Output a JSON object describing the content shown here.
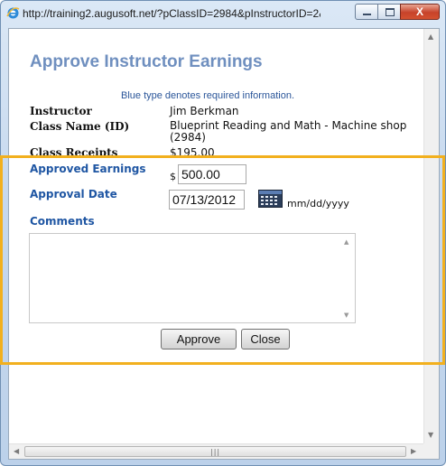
{
  "window": {
    "title": "http://training2.augusoft.net/?pClassID=2984&pInstructorID=2& - ...",
    "close_glyph": "X"
  },
  "page": {
    "heading": "Approve Instructor Earnings",
    "required_note": "Blue type denotes required information.",
    "fields": {
      "instructor_label": "Instructor",
      "instructor_value": "Jim Berkman",
      "class_label": "Class Name (ID)",
      "class_value": "Blueprint Reading and Math - Machine shop (2984)",
      "receipts_label": "Class Receipts",
      "receipts_value": "$195.00"
    },
    "form": {
      "earnings_label": "Approved Earnings",
      "currency_symbol": "$",
      "earnings_value": "500.00",
      "date_label": "Approval Date",
      "date_value": "07/13/2012",
      "date_format": "mm/dd/yyyy",
      "comments_label": "Comments",
      "comments_value": ""
    },
    "buttons": {
      "approve": "Approve",
      "close": "Close"
    }
  },
  "colors": {
    "heading": "#6f8fbf",
    "required_blue": "#1f56a3",
    "highlight": "#f2b01e"
  },
  "icons": [
    "ie-icon",
    "calendar-icon"
  ]
}
